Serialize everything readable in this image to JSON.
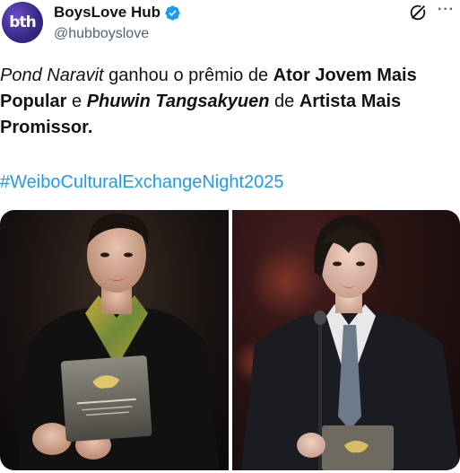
{
  "author": {
    "display_name": "BoysLove Hub",
    "handle": "@hubboyslove",
    "avatar_text": "bth",
    "verified": true
  },
  "icons": {
    "verified": "verified-badge-icon",
    "grok": "grok-icon",
    "more": "more-options-icon"
  },
  "more_glyph": "···",
  "tweet": {
    "part1": "Pond Naravit",
    "part2": " ganhou o prêmio de ",
    "part3": "Ator Jovem Mais Popular",
    "part4": " e ",
    "part5": "Phuwin Tangsakyuen",
    "part6": " de ",
    "part7": "Artista Mais Promissor.",
    "hashtag": "#WeiboCulturalExchangeNight2025"
  },
  "media": {
    "count": 2,
    "plaque_lines": [
      "WEIBO GALA",
      "2025 Weibo Cultural Exchange",
      "Ator Jovem Mais Popular"
    ]
  },
  "colors": {
    "text": "#0f1419",
    "secondary": "#536471",
    "link": "#1d9bf0",
    "verified": "#1d9bf0"
  }
}
